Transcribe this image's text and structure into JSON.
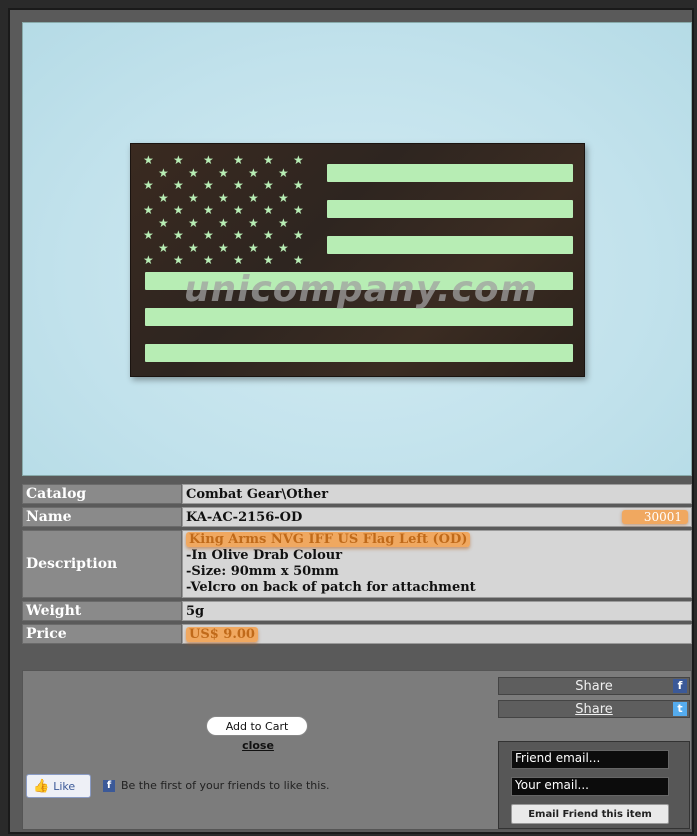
{
  "product": {
    "watermark": "unicompany.com",
    "code_badge": "30001"
  },
  "info": {
    "catalog_label": "Catalog",
    "catalog_value": "Combat Gear\\Other",
    "name_label": "Name",
    "name_value": "KA-AC-2156-OD",
    "description_label": "Description",
    "description_lines": [
      "King Arms NVG IFF US Flag Left (OD)",
      "-In Olive Drab Colour",
      "-Size: 90mm x 50mm",
      "-Velcro on back of patch for attachment"
    ],
    "weight_label": "Weight",
    "weight_value": "5g",
    "price_label": "Price",
    "price_value": "US$ 9.00"
  },
  "actions": {
    "add_to_cart": "Add to Cart",
    "close": "close",
    "like": "Like",
    "like_text": "Be the first of your friends to like this.",
    "share_facebook": "Share",
    "share_twitter": "Share",
    "friend_email_placeholder": "Friend email...",
    "your_email_placeholder": "Your email...",
    "email_friend_button": "Email Friend this item"
  },
  "icons": {
    "thumb": "thumbs-up-icon",
    "facebook": "facebook-icon",
    "twitter": "twitter-icon"
  },
  "colors": {
    "highlight": "#f0a860",
    "label_bg": "#8a8a8a",
    "value_bg": "#d6d6d6",
    "glow_green": "#b7edb4"
  }
}
